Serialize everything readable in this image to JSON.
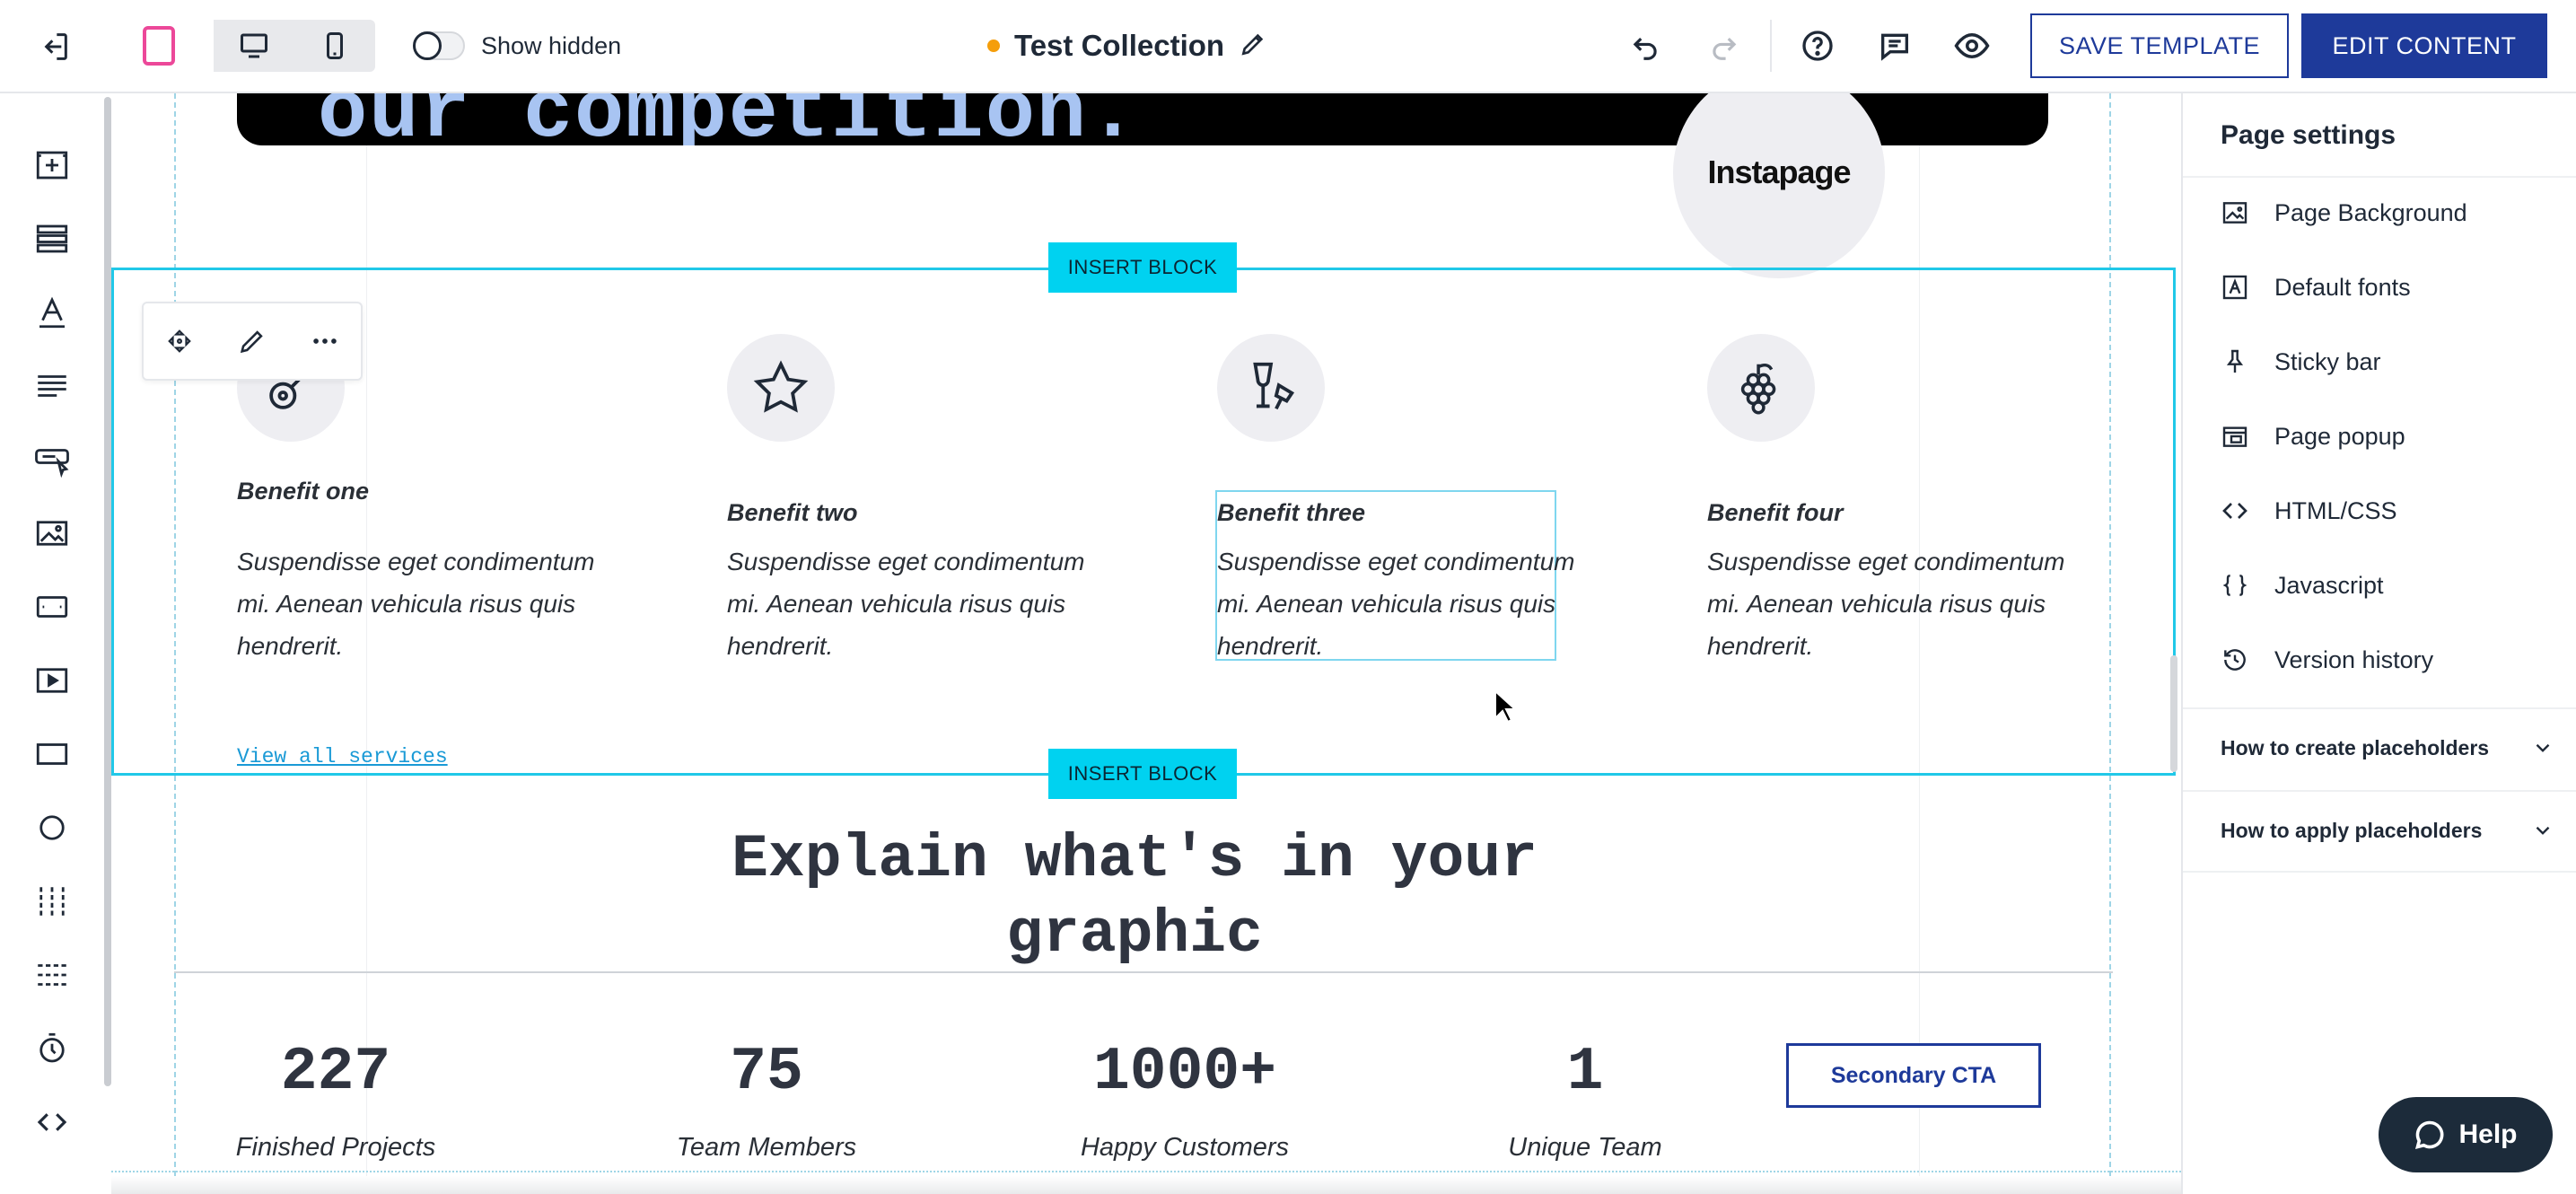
{
  "topbar": {
    "show_hidden_label": "Show hidden",
    "doc_title": "Test Collection",
    "save_template_label": "SAVE TEMPLATE",
    "edit_content_label": "EDIT CONTENT",
    "unsaved_color": "#f59e0b",
    "brand_color": "#1e3a9a"
  },
  "left_rail": {
    "items": [
      "add-section-icon",
      "sections-icon",
      "text-icon",
      "paragraph-icon",
      "button-icon",
      "image-icon",
      "form-icon",
      "video-icon",
      "box-icon",
      "circle-icon",
      "columns-icon",
      "divider-icon",
      "timer-icon",
      "code-icon"
    ]
  },
  "canvas": {
    "hero_text": "our competition.",
    "logo_text": "Instapage",
    "insert_block_label": "INSERT BLOCK",
    "insert_block_color": "#00d2f0",
    "benefits": [
      {
        "title": "Benefit one",
        "body": "Suspendisse eget condimentum mi. Aenean vehicula risus quis hendrerit.",
        "icon": "guitar-icon"
      },
      {
        "title": "Benefit two",
        "body": "Suspendisse eget condimentum mi. Aenean vehicula risus quis hendrerit.",
        "icon": "star-icon"
      },
      {
        "title": "Benefit three",
        "body": "Suspendisse eget condimentum mi. Aenean vehicula risus quis hendrerit.",
        "icon": "wine-glasses-icon"
      },
      {
        "title": "Benefit four",
        "body": "Suspendisse eget condimentum mi. Aenean vehicula risus quis hendrerit.",
        "icon": "grapes-icon"
      }
    ],
    "view_all_link": "View all services",
    "explain_heading": "Explain what's in your graphic",
    "stats": [
      {
        "value": "227",
        "label": "Finished Projects"
      },
      {
        "value": "75",
        "label": "Team Members"
      },
      {
        "value": "1000+",
        "label": "Happy Customers"
      },
      {
        "value": "1",
        "label": "Unique Team"
      }
    ],
    "secondary_cta_label": "Secondary CTA"
  },
  "page_settings": {
    "title": "Page settings",
    "items": [
      {
        "label": "Page Background",
        "icon": "image-icon"
      },
      {
        "label": "Default fonts",
        "icon": "font-icon"
      },
      {
        "label": "Sticky bar",
        "icon": "pin-icon"
      },
      {
        "label": "Page popup",
        "icon": "popup-icon"
      },
      {
        "label": "HTML/CSS",
        "icon": "code-icon"
      },
      {
        "label": "Javascript",
        "icon": "braces-icon"
      },
      {
        "label": "Version history",
        "icon": "history-icon"
      }
    ],
    "accordions": [
      {
        "label": "How to create placeholders"
      },
      {
        "label": "How to apply placeholders"
      }
    ]
  },
  "help": {
    "label": "Help"
  }
}
